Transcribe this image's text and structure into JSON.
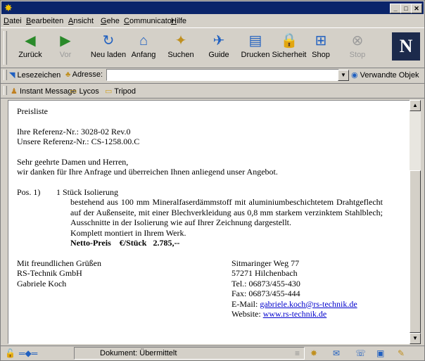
{
  "menu": [
    "Datei",
    "Bearbeiten",
    "Ansicht",
    "Gehe",
    "Communicator",
    "Hilfe"
  ],
  "menu_underline": [
    "D",
    "B",
    "A",
    "G",
    "C",
    "H"
  ],
  "toolbar": [
    {
      "label": "Zurück",
      "icon": "back-arrow-icon",
      "glyph": "◀",
      "color": "#2a8a2a",
      "disabled": false
    },
    {
      "label": "Vor",
      "icon": "forward-arrow-icon",
      "glyph": "▶",
      "color": "#2a8a2a",
      "disabled": true
    },
    {
      "label": "Neu laden",
      "icon": "reload-icon",
      "glyph": "↻",
      "color": "#2060c0",
      "disabled": false
    },
    {
      "label": "Anfang",
      "icon": "home-icon",
      "glyph": "⌂",
      "color": "#2060c0",
      "disabled": false
    },
    {
      "label": "Suchen",
      "icon": "search-icon",
      "glyph": "✦",
      "color": "#c09020",
      "disabled": false
    },
    {
      "label": "Guide",
      "icon": "guide-icon",
      "glyph": "✈",
      "color": "#2060c0",
      "disabled": false
    },
    {
      "label": "Drucken",
      "icon": "print-icon",
      "glyph": "▤",
      "color": "#2060c0",
      "disabled": false
    },
    {
      "label": "Sicherheit",
      "icon": "lock-icon",
      "glyph": "🔒",
      "color": "#c08020",
      "disabled": false
    },
    {
      "label": "Shop",
      "icon": "shop-icon",
      "glyph": "⊞",
      "color": "#2060c0",
      "disabled": false
    },
    {
      "label": "Stop",
      "icon": "stop-icon",
      "glyph": "⊗",
      "color": "#9a9a9a",
      "disabled": true
    }
  ],
  "logo": "N",
  "location": {
    "bookmarks_label": "Lesezeichen",
    "address_label": "Adresse:",
    "url": "",
    "related_label": "Verwandte Objek"
  },
  "personal_bar": [
    "Instant Message",
    "Lycos",
    "Tripod"
  ],
  "doc": {
    "title": "Preisliste",
    "ref1": "Ihre Referenz-Nr.: 3028-02 Rev.0",
    "ref2": "Unsere Referenz-Nr.: CS-1258.00.C",
    "greeting": "Sehr geehrte Damen und Herren,",
    "intro": "wir danken für Ihre Anfrage und überreichen Ihnen anliegend unser Angebot.",
    "pos_tag": "Pos. 1)",
    "pos_title": "1 Stück Isolierung",
    "pos_desc": "bestehend aus 100 mm Mineralfaserdämmstoff mit aluminiumbeschichtetem Drahtgeflecht auf der Außenseite, mit einer Blechverkleidung aus 0,8 mm starkem verzinktem Stahlblech; Ausschnitte in der Isolierung wie auf Ihrer Zeichnung dargestellt.",
    "pos_mount": "Komplett montiert in Ihrem Werk.",
    "netto_label": "Netto-Preis",
    "netto_unit": "€/Stück",
    "netto_value": "2.785,--",
    "closing": [
      "Mit freundlichen Grüßen",
      "RS-Technik GmbH",
      "Gabriele Koch"
    ],
    "address": [
      "Sitmaringer Weg 77",
      "57271 Hilchenbach",
      "Tel.: 06873/455-430",
      "Fax: 06873/455-444"
    ],
    "email_label": "E-Mail:",
    "email": "gabriele.koch@rs-technik.de",
    "website_label": "Website:",
    "website": "www.rs-technik.de"
  },
  "status": {
    "text": "Dokument: Übermittelt"
  }
}
